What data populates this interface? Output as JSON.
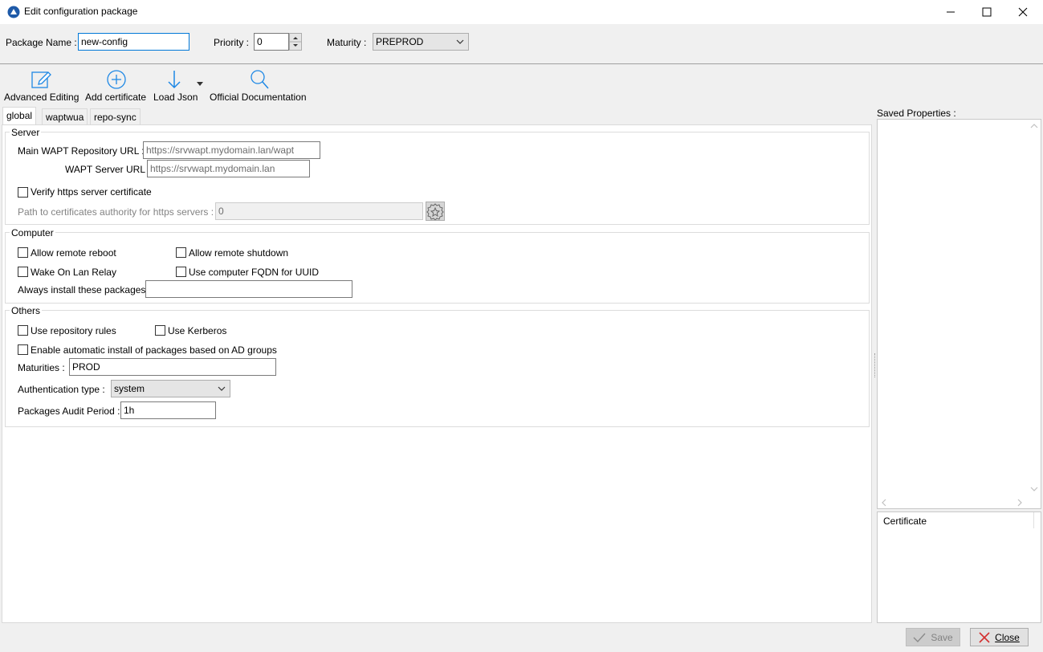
{
  "window": {
    "title": "Edit configuration package",
    "minimize_label": "—",
    "maximize_label": "☐",
    "close_label": "✕"
  },
  "header": {
    "package_name_label": "Package Name :",
    "package_name_value": "new-config",
    "priority_label": "Priority :",
    "priority_value": "0",
    "maturity_label": "Maturity :",
    "maturity_value": "PREPROD"
  },
  "toolbar": {
    "advanced_editing": "Advanced Editing",
    "add_certificate": "Add certificate",
    "load_json": "Load Json",
    "official_documentation": "Official Documentation"
  },
  "tabs": [
    {
      "label": "global",
      "active": true
    },
    {
      "label": "waptwua",
      "active": false
    },
    {
      "label": "repo-sync",
      "active": false
    }
  ],
  "server": {
    "title": "Server",
    "main_repo_label": "Main WAPT Repository URL :",
    "main_repo_placeholder": "https://srvwapt.mydomain.lan/wapt",
    "server_url_label": "WAPT Server URL :",
    "server_url_placeholder": "https://srvwapt.mydomain.lan",
    "verify_https_label": "Verify https server certificate",
    "ca_path_label": "Path to certificates authority for https servers :",
    "ca_path_value": "0"
  },
  "computer": {
    "title": "Computer",
    "allow_reboot_label": "Allow remote reboot",
    "allow_shutdown_label": "Allow remote shutdown",
    "wol_relay_label": "Wake On Lan Relay",
    "fqdn_uuid_label": "Use computer FQDN for UUID",
    "always_install_label": "Always install these packages",
    "always_install_value": ""
  },
  "others": {
    "title": "Others",
    "repo_rules_label": "Use repository rules",
    "kerberos_label": "Use Kerberos",
    "ad_groups_label": "Enable automatic install of packages based on AD groups",
    "maturities_label": "Maturities :",
    "maturities_value": "PROD",
    "auth_type_label": "Authentication type :",
    "auth_type_value": "system",
    "audit_period_label": "Packages Audit Period :",
    "audit_period_value": "1h"
  },
  "side": {
    "saved_properties_label": "Saved Properties :",
    "certificate_label": "Certificate"
  },
  "footer": {
    "save_label": "Save",
    "close_label": "Close"
  },
  "colors": {
    "accent": "#0078d7",
    "icon_blue": "#1e88e5",
    "close_red": "#d32f2f"
  }
}
